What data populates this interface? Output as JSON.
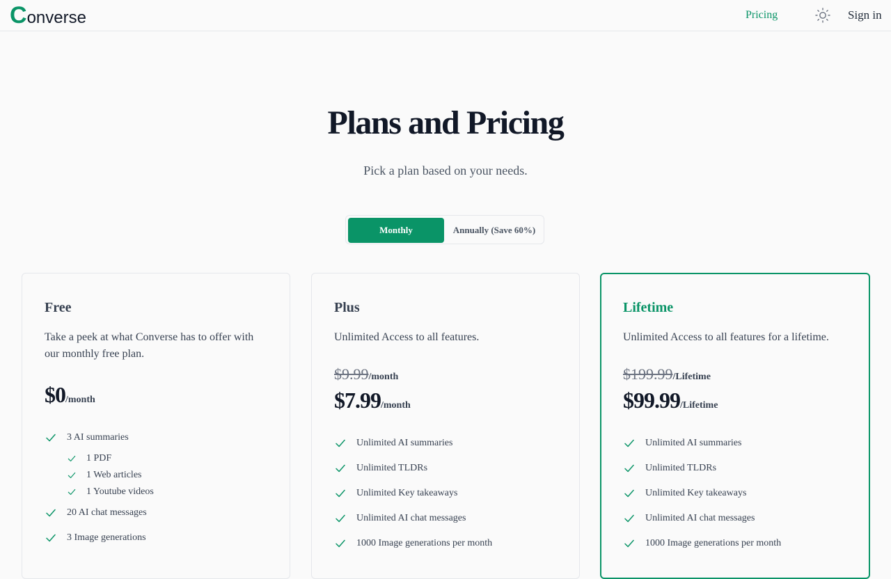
{
  "header": {
    "logo_initial": "C",
    "logo_rest": "onverse",
    "nav_pricing": "Pricing",
    "theme_icon": "sun-icon",
    "sign_in": "Sign in"
  },
  "hero": {
    "title": "Plans and Pricing",
    "subtitle": "Pick a plan based on your needs."
  },
  "billing_toggle": {
    "selected": "Monthly",
    "monthly_label": "Monthly",
    "annual_label": "Annually (Save 60%)"
  },
  "colors": {
    "accent": "#0a9467",
    "text": "#111827",
    "muted": "#374151",
    "border": "#e5e7eb",
    "background": "#fafafa"
  },
  "plans": [
    {
      "name": "Free",
      "description": "Take a peek at what Converse has to offer with our monthly free plan.",
      "price": "$0",
      "price_unit": "/month",
      "features": [
        {
          "label": "3 AI summaries",
          "sub": [
            "1 PDF",
            "1 Web articles",
            "1 Youtube videos"
          ]
        },
        {
          "label": "20 AI chat messages"
        },
        {
          "label": "3 Image generations"
        }
      ]
    },
    {
      "name": "Plus",
      "description": "Unlimited Access to all features.",
      "old_price": "$9.99",
      "old_price_unit": "/month",
      "price": "$7.99",
      "price_unit": "/month",
      "features": [
        {
          "label": "Unlimited AI summaries"
        },
        {
          "label": "Unlimited TLDRs"
        },
        {
          "label": "Unlimited Key takeaways"
        },
        {
          "label": "Unlimited AI chat messages"
        },
        {
          "label": "1000 Image generations per month"
        }
      ]
    },
    {
      "name": "Lifetime",
      "description": "Unlimited Access to all features for a lifetime.",
      "old_price": "$199.99",
      "old_price_unit": "/Lifetime",
      "price": "$99.99",
      "price_unit": "/Lifetime",
      "features": [
        {
          "label": "Unlimited AI summaries"
        },
        {
          "label": "Unlimited TLDRs"
        },
        {
          "label": "Unlimited Key takeaways"
        },
        {
          "label": "Unlimited AI chat messages"
        },
        {
          "label": "1000 Image generations per month"
        }
      ]
    }
  ]
}
